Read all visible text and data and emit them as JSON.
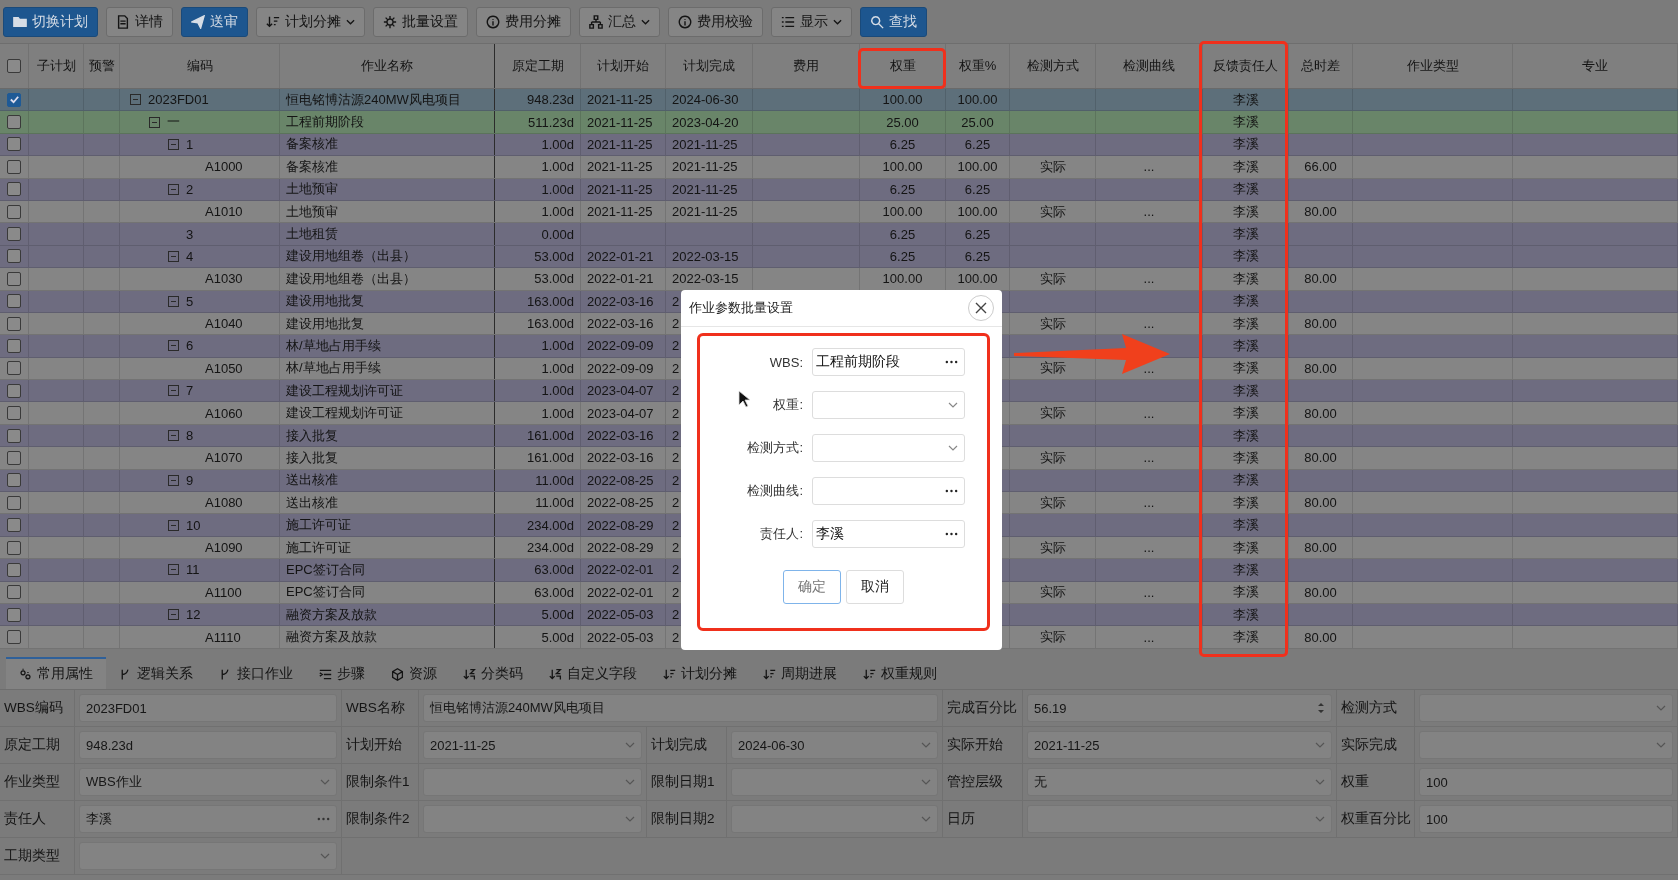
{
  "toolbar": [
    {
      "label": "切换计划",
      "primary": true,
      "dropdown": false
    },
    {
      "label": "详情",
      "primary": false,
      "dropdown": false
    },
    {
      "label": "送审",
      "primary": true,
      "dropdown": false
    },
    {
      "label": "计划分摊",
      "primary": false,
      "dropdown": true
    },
    {
      "label": "批量设置",
      "primary": false,
      "dropdown": false
    },
    {
      "label": "费用分摊",
      "primary": false,
      "dropdown": false
    },
    {
      "label": "汇总",
      "primary": false,
      "dropdown": true
    },
    {
      "label": "费用校验",
      "primary": false,
      "dropdown": false
    },
    {
      "label": "显示",
      "primary": false,
      "dropdown": true
    },
    {
      "label": "查找",
      "primary": true,
      "dropdown": false
    }
  ],
  "table": {
    "select_all": {
      "checked": false
    },
    "columns": [
      "子计划",
      "预警",
      "编码",
      "作业名称",
      "原定工期",
      "计划开始",
      "计划完成",
      "费用",
      "权重",
      "权重%",
      "检测方式",
      "检测曲线",
      "反馈责任人",
      "总时差",
      "作业类型",
      "专业"
    ],
    "rows": [
      {
        "kind": "project",
        "selected": true,
        "expanded": true,
        "code": "2023FD01",
        "name": "恒电铭博沽源240MW风电项目",
        "duration": "948.23d",
        "start": "2021-11-25",
        "finish": "2024-06-30",
        "weight": "100.00",
        "weight_pct": "100.00",
        "owner": "李溪",
        "children": [
          {
            "kind": "phase",
            "selected": false,
            "expanded": true,
            "code": "一",
            "name": "工程前期阶段",
            "duration": "511.23d",
            "start": "2021-11-25",
            "finish": "2023-04-20",
            "weight": "25.00",
            "weight_pct": "25.00",
            "owner": "李溪",
            "children": [
              {
                "kind": "wbs",
                "selected": false,
                "expanded": true,
                "code": "1",
                "name": "备案核准",
                "duration": "1.00d",
                "start": "2021-11-25",
                "finish": "2021-11-25",
                "weight": "6.25",
                "weight_pct": "6.25",
                "owner": "李溪",
                "children": [
                  {
                    "kind": "activity",
                    "selected": false,
                    "code": "A1000",
                    "name": "备案核准",
                    "duration": "1.00d",
                    "start": "2021-11-25",
                    "finish": "2021-11-25",
                    "weight": "100.00",
                    "weight_pct": "100.00",
                    "check_method": "实际",
                    "curve": "...",
                    "owner": "李溪",
                    "float": "66.00"
                  }
                ]
              },
              {
                "kind": "wbs",
                "selected": false,
                "expanded": true,
                "code": "2",
                "name": "土地预审",
                "duration": "1.00d",
                "start": "2021-11-25",
                "finish": "2021-11-25",
                "weight": "6.25",
                "weight_pct": "6.25",
                "owner": "李溪",
                "children": [
                  {
                    "kind": "activity",
                    "selected": false,
                    "code": "A1010",
                    "name": "土地预审",
                    "duration": "1.00d",
                    "start": "2021-11-25",
                    "finish": "2021-11-25",
                    "weight": "100.00",
                    "weight_pct": "100.00",
                    "check_method": "实际",
                    "curve": "...",
                    "owner": "李溪",
                    "float": "80.00"
                  }
                ]
              },
              {
                "kind": "wbs",
                "selected": false,
                "code": "3",
                "name": "土地租赁",
                "duration": "0.00d",
                "weight": "6.25",
                "weight_pct": "6.25",
                "owner": "李溪"
              },
              {
                "kind": "wbs",
                "selected": false,
                "expanded": true,
                "code": "4",
                "name": "建设用地组卷（出县）",
                "duration": "53.00d",
                "start": "2022-01-21",
                "finish": "2022-03-15",
                "weight": "6.25",
                "weight_pct": "6.25",
                "owner": "李溪",
                "children": [
                  {
                    "kind": "activity",
                    "selected": false,
                    "code": "A1030",
                    "name": "建设用地组卷（出县）",
                    "duration": "53.00d",
                    "start": "2022-01-21",
                    "finish": "2022-03-15",
                    "weight": "100.00",
                    "weight_pct": "100.00",
                    "check_method": "实际",
                    "curve": "...",
                    "owner": "李溪",
                    "float": "80.00"
                  }
                ]
              },
              {
                "kind": "wbs",
                "selected": false,
                "expanded": true,
                "code": "5",
                "name": "建设用地批复",
                "duration": "163.00d",
                "start": "2022-03-16",
                "finish": "2",
                "owner": "李溪",
                "children": [
                  {
                    "kind": "activity",
                    "selected": false,
                    "code": "A1040",
                    "name": "建设用地批复",
                    "duration": "163.00d",
                    "start": "2022-03-16",
                    "finish": "2",
                    "check_method": "实际",
                    "curve": "...",
                    "owner": "李溪",
                    "float": "80.00"
                  }
                ]
              },
              {
                "kind": "wbs",
                "selected": false,
                "expanded": true,
                "code": "6",
                "name": "林/草地占用手续",
                "duration": "1.00d",
                "start": "2022-09-09",
                "finish": "2",
                "owner": "李溪",
                "children": [
                  {
                    "kind": "activity",
                    "selected": false,
                    "code": "A1050",
                    "name": "林/草地占用手续",
                    "duration": "1.00d",
                    "start": "2022-09-09",
                    "finish": "2",
                    "check_method": "实际",
                    "curve": "...",
                    "owner": "李溪",
                    "float": "80.00"
                  }
                ]
              },
              {
                "kind": "wbs",
                "selected": false,
                "expanded": true,
                "code": "7",
                "name": "建设工程规划许可证",
                "duration": "1.00d",
                "start": "2023-04-07",
                "finish": "2",
                "owner": "李溪",
                "children": [
                  {
                    "kind": "activity",
                    "selected": false,
                    "code": "A1060",
                    "name": "建设工程规划许可证",
                    "duration": "1.00d",
                    "start": "2023-04-07",
                    "finish": "2",
                    "check_method": "实际",
                    "curve": "...",
                    "owner": "李溪",
                    "float": "80.00"
                  }
                ]
              },
              {
                "kind": "wbs",
                "selected": false,
                "expanded": true,
                "code": "8",
                "name": "接入批复",
                "duration": "161.00d",
                "start": "2022-03-16",
                "finish": "2",
                "owner": "李溪",
                "children": [
                  {
                    "kind": "activity",
                    "selected": false,
                    "code": "A1070",
                    "name": "接入批复",
                    "duration": "161.00d",
                    "start": "2022-03-16",
                    "finish": "2",
                    "check_method": "实际",
                    "curve": "...",
                    "owner": "李溪",
                    "float": "80.00"
                  }
                ]
              },
              {
                "kind": "wbs",
                "selected": false,
                "expanded": true,
                "code": "9",
                "name": "送出核准",
                "duration": "11.00d",
                "start": "2022-08-25",
                "finish": "2",
                "owner": "李溪",
                "children": [
                  {
                    "kind": "activity",
                    "selected": false,
                    "code": "A1080",
                    "name": "送出核准",
                    "duration": "11.00d",
                    "start": "2022-08-25",
                    "finish": "2",
                    "check_method": "实际",
                    "curve": "...",
                    "owner": "李溪",
                    "float": "80.00"
                  }
                ]
              },
              {
                "kind": "wbs",
                "selected": false,
                "expanded": true,
                "code": "10",
                "name": "施工许可证",
                "duration": "234.00d",
                "start": "2022-08-29",
                "finish": "2",
                "owner": "李溪",
                "children": [
                  {
                    "kind": "activity",
                    "selected": false,
                    "code": "A1090",
                    "name": "施工许可证",
                    "duration": "234.00d",
                    "start": "2022-08-29",
                    "finish": "2",
                    "check_method": "实际",
                    "curve": "...",
                    "owner": "李溪",
                    "float": "80.00"
                  }
                ]
              },
              {
                "kind": "wbs",
                "selected": false,
                "expanded": true,
                "code": "11",
                "name": "EPC签订合同",
                "duration": "63.00d",
                "start": "2022-02-01",
                "finish": "2",
                "owner": "李溪",
                "children": [
                  {
                    "kind": "activity",
                    "selected": false,
                    "code": "A1100",
                    "name": "EPC签订合同",
                    "duration": "63.00d",
                    "start": "2022-02-01",
                    "finish": "2",
                    "check_method": "实际",
                    "curve": "...",
                    "owner": "李溪",
                    "float": "80.00"
                  }
                ]
              },
              {
                "kind": "wbs",
                "selected": false,
                "expanded": true,
                "code": "12",
                "name": "融资方案及放款",
                "duration": "5.00d",
                "start": "2022-05-03",
                "finish": "2",
                "owner": "李溪",
                "children": [
                  {
                    "kind": "activity",
                    "selected": false,
                    "code": "A1110",
                    "name": "融资方案及放款",
                    "duration": "5.00d",
                    "start": "2022-05-03",
                    "finish": "2",
                    "check_method": "实际",
                    "curve": "...",
                    "owner": "李溪",
                    "float": "80.00"
                  }
                ]
              }
            ]
          }
        ]
      }
    ]
  },
  "detail_tabs": [
    {
      "label": "常用属性",
      "selected": true
    },
    {
      "label": "逻辑关系",
      "selected": false
    },
    {
      "label": "接口作业",
      "selected": false
    },
    {
      "label": "步骤",
      "selected": false
    },
    {
      "label": "资源",
      "selected": false
    },
    {
      "label": "分类码",
      "selected": false
    },
    {
      "label": "自定义字段",
      "selected": false
    },
    {
      "label": "计划分摊",
      "selected": false
    },
    {
      "label": "周期进展",
      "selected": false
    },
    {
      "label": "权重规则",
      "selected": false
    }
  ],
  "form": {
    "fields": [
      {
        "label": "WBS编码",
        "kind": "text",
        "value": "2023FD01"
      },
      {
        "label": "WBS名称",
        "kind": "wide_text",
        "value": "恒电铭博沽源240MW风电项目"
      },
      {
        "label": "完成百分比",
        "kind": "spinner",
        "value": "56.19"
      },
      {
        "label": "检测方式",
        "kind": "select"
      },
      {
        "label": "原定工期",
        "kind": "text",
        "value": "948.23d"
      },
      {
        "label": "计划开始",
        "kind": "select",
        "value": "2021-11-25"
      },
      {
        "label": "计划完成",
        "kind": "select",
        "value": "2024-06-30"
      },
      {
        "label": "实际开始",
        "kind": "select",
        "value": "2021-11-25"
      },
      {
        "label": "实际完成",
        "kind": "select"
      },
      {
        "label": "作业类型",
        "kind": "select",
        "value": "WBS作业"
      },
      {
        "label": "限制条件1",
        "kind": "select"
      },
      {
        "label": "限制日期1",
        "kind": "select"
      },
      {
        "label": "管控层级",
        "kind": "select",
        "value": "无"
      },
      {
        "label": "权重",
        "kind": "text",
        "value": "100"
      },
      {
        "label": "责任人",
        "kind": "picker",
        "value": "李溪"
      },
      {
        "label": "限制条件2",
        "kind": "select"
      },
      {
        "label": "限制日期2",
        "kind": "select"
      },
      {
        "label": "日历",
        "kind": "select"
      },
      {
        "label": "权重百分比",
        "kind": "text",
        "value": "100"
      },
      {
        "label": "工期类型",
        "kind": "select"
      }
    ]
  },
  "dialog": {
    "title": "作业参数批量设置",
    "fields": [
      {
        "label": "WBS:",
        "kind": "picker",
        "value": "工程前期阶段"
      },
      {
        "label": "权重:",
        "kind": "select"
      },
      {
        "label": "检测方式:",
        "kind": "select"
      },
      {
        "label": "检测曲线:",
        "kind": "picker"
      },
      {
        "label": "责任人:",
        "kind": "picker",
        "value": "李溪"
      }
    ],
    "buttons": [
      {
        "label": "确定",
        "focused": true
      },
      {
        "label": "取消",
        "focused": false
      }
    ]
  }
}
